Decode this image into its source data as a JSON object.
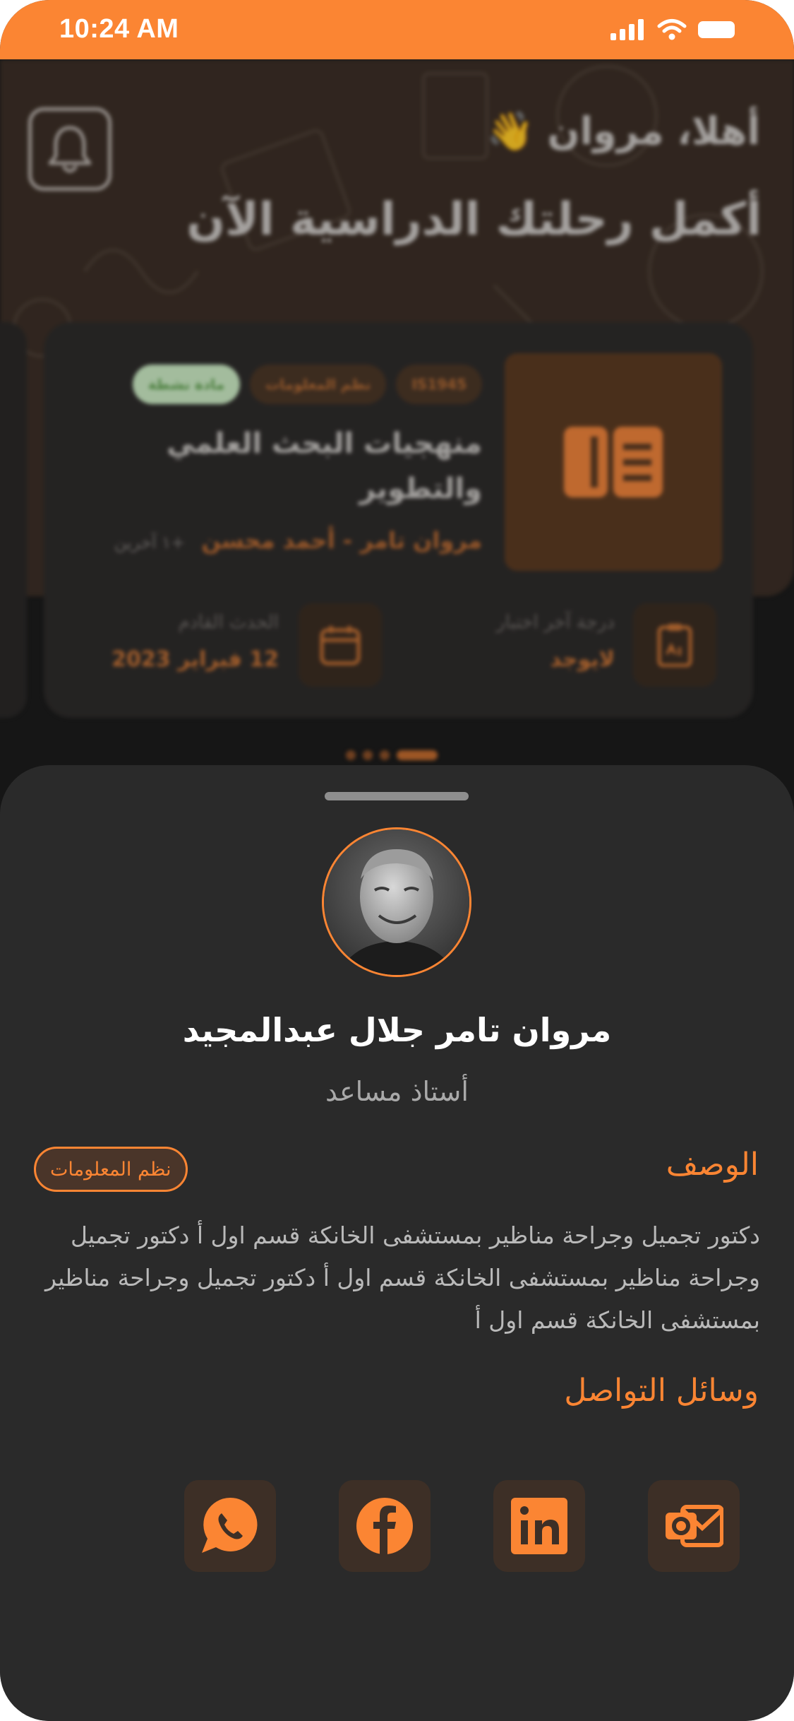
{
  "status_bar": {
    "time": "10:24 AM"
  },
  "hero": {
    "greeting": "أهلا، مروان 👋",
    "title": "أكمل رحلتك الدراسية الآن"
  },
  "course_card": {
    "code": "IS1945",
    "department": "نظم المعلومات",
    "status": "مادة نشطة",
    "title": "منهجيات البحث العلمي والتطوير",
    "teachers": "مروان تامر - أحمد محسن",
    "more_teachers": "+١ آخرين",
    "last_exam_label": "درجة آخر اختبار",
    "last_exam_value": "لايوجد",
    "next_event_label": "الحدث القادم",
    "next_event_value": "12 فبراير 2023"
  },
  "profile": {
    "name": "مروان تامر جلال عبدالمجيد",
    "role": "أستاذ مساعد",
    "department_tag": "نظم المعلومات",
    "description_title": "الوصف",
    "description": "دكتور تجميل وجراحة مناظير بمستشفى الخانكة قسم اول أ دكتور تجميل وجراحة مناظير بمستشفى الخانكة قسم اول أ دكتور تجميل وجراحة مناظير بمستشفى الخانكة قسم اول أ",
    "contact_title": "وسائل التواصل",
    "contacts": [
      "outlook-icon",
      "linkedin-icon",
      "facebook-icon",
      "whatsapp-icon"
    ]
  },
  "colors": {
    "accent": "#fb8533",
    "sheet": "#2a2a2a",
    "icon_bg": "#3d2f26"
  }
}
